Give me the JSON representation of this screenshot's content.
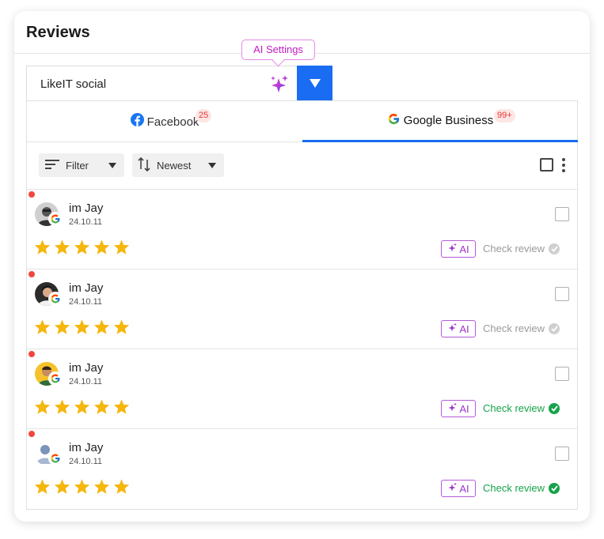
{
  "header": {
    "title": "Reviews"
  },
  "ai_tooltip": "AI Settings",
  "account": {
    "name": "LikeIT social"
  },
  "tabs": [
    {
      "label": "Facebook",
      "badge": "25",
      "active": false
    },
    {
      "label": "Google Business",
      "badge": "99+",
      "active": true
    }
  ],
  "toolbar": {
    "filter_label": "Filter",
    "sort_label": "Newest"
  },
  "reviews": [
    {
      "name": "im Jay",
      "date": "24.10.11",
      "stars": 5,
      "ai_label": "AI",
      "check_label": "Check review",
      "checked": false,
      "unread": true,
      "avatar": "photo-gray"
    },
    {
      "name": "im Jay",
      "date": "24.10.11",
      "stars": 5,
      "ai_label": "AI",
      "check_label": "Check review",
      "checked": false,
      "unread": true,
      "avatar": "photo-dark"
    },
    {
      "name": "im Jay",
      "date": "24.10.11",
      "stars": 5,
      "ai_label": "AI",
      "check_label": "Check review",
      "checked": true,
      "unread": true,
      "avatar": "photo-yellow"
    },
    {
      "name": "im Jay",
      "date": "24.10.11",
      "stars": 5,
      "ai_label": "AI",
      "check_label": "Check review",
      "checked": true,
      "unread": true,
      "avatar": "default-user"
    }
  ],
  "colors": {
    "accent": "#1a6cf2",
    "star": "#f5b70e",
    "checked": "#16a34a",
    "unchecked": "#9a9a9a",
    "ai": "#9a36c9",
    "unread": "#f0473e",
    "badge_text": "#e53935"
  },
  "icons": {
    "sparkle": "sparkle-icon",
    "facebook": "facebook-icon",
    "google": "google-icon",
    "filter": "filter-icon",
    "sort": "sort-icon",
    "kebab": "more-vertical-icon",
    "star": "star-icon",
    "check": "check-circle-icon"
  }
}
